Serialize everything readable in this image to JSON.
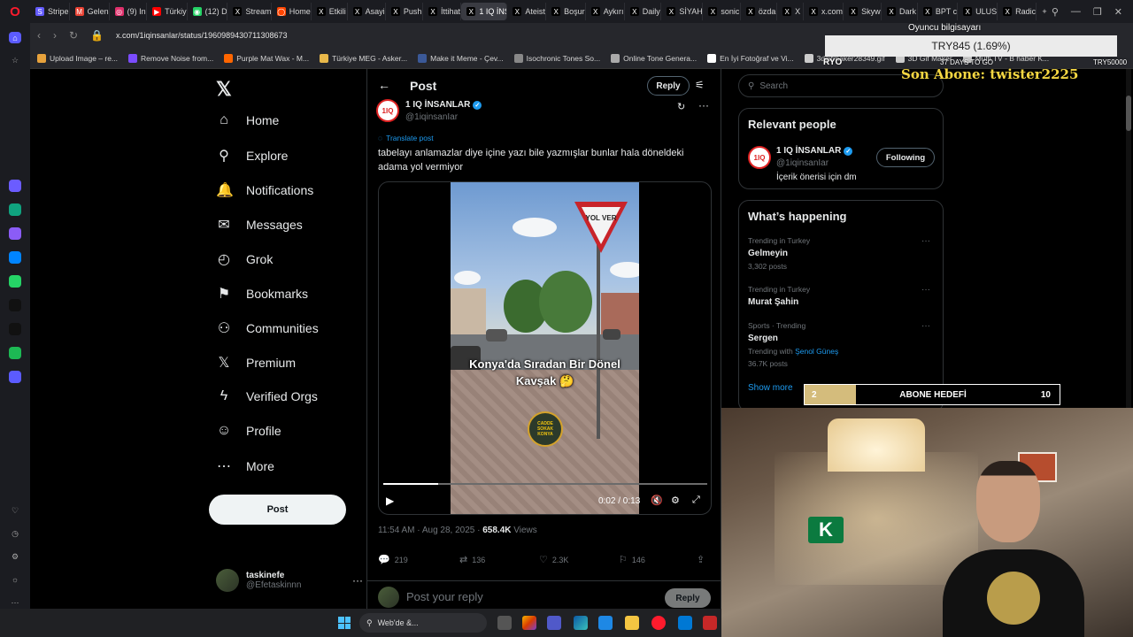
{
  "browser": {
    "tabs": [
      {
        "label": "Stripe",
        "color": "#635bff",
        "glyph": "S"
      },
      {
        "label": "Gelen",
        "color": "#ea4335",
        "glyph": "M"
      },
      {
        "label": "(9) In",
        "color": "#e1306c",
        "glyph": "◎"
      },
      {
        "label": "Türkiy",
        "color": "#ff0000",
        "glyph": "▶"
      },
      {
        "label": "(12) D",
        "color": "#25d366",
        "glyph": "◉"
      },
      {
        "label": "Stream",
        "color": "#000000",
        "glyph": "X"
      },
      {
        "label": "Home",
        "color": "#ff4500",
        "glyph": "◯"
      },
      {
        "label": "Etkili",
        "color": "#000000",
        "glyph": "X"
      },
      {
        "label": "Asayi",
        "color": "#000000",
        "glyph": "X"
      },
      {
        "label": "Push",
        "color": "#000000",
        "glyph": "X"
      },
      {
        "label": "İttihat",
        "color": "#000000",
        "glyph": "X"
      },
      {
        "label": "1 IQ İNSAN",
        "color": "#000000",
        "glyph": "X",
        "active": true
      },
      {
        "label": "Ateist",
        "color": "#000000",
        "glyph": "X"
      },
      {
        "label": "Boşur",
        "color": "#000000",
        "glyph": "X"
      },
      {
        "label": "Aykırı",
        "color": "#000000",
        "glyph": "X"
      },
      {
        "label": "Daily",
        "color": "#000000",
        "glyph": "X"
      },
      {
        "label": "SİYAH",
        "color": "#000000",
        "glyph": "X"
      },
      {
        "label": "sonic",
        "color": "#000000",
        "glyph": "X"
      },
      {
        "label": "özda",
        "color": "#000000",
        "glyph": "X"
      },
      {
        "label": "X",
        "color": "#000000",
        "glyph": "X"
      },
      {
        "label": "x.com",
        "color": "#000000",
        "glyph": "X"
      },
      {
        "label": "Skyw",
        "color": "#000000",
        "glyph": "X"
      },
      {
        "label": "Dark",
        "color": "#000000",
        "glyph": "X"
      },
      {
        "label": "BPT c",
        "color": "#000000",
        "glyph": "X"
      },
      {
        "label": "ULUS",
        "color": "#000000",
        "glyph": "X"
      },
      {
        "label": "Radic",
        "color": "#000000",
        "glyph": "X"
      }
    ],
    "new_tab": "+",
    "url": "x.com/1iqinsanlar/status/1960989430711308673",
    "bookmarks": [
      {
        "label": "Upload Image – re...",
        "color": "#e7a23c"
      },
      {
        "label": "Remove Noise from...",
        "color": "#7b4cff"
      },
      {
        "label": "Purple Mat Wax - M...",
        "color": "#ff6600"
      },
      {
        "label": "Türkiye MEG - Asker...",
        "color": "#e8b84a"
      },
      {
        "label": "Make it Meme - Çev...",
        "color": "#3b5998"
      },
      {
        "label": "Isochronic Tones So...",
        "color": "#888888"
      },
      {
        "label": "Online Tone Genera...",
        "color": "#aaaaaa"
      },
      {
        "label": "En İyi Fotoğraf ve Vi...",
        "color": "#ffffff"
      },
      {
        "label": "3dgifmaker28349.gif",
        "color": "#cccccc"
      },
      {
        "label": "3D Gif Maker",
        "color": "#cccccc"
      },
      {
        "label": "Multi TV - B haber K...",
        "color": "#cccccc"
      }
    ]
  },
  "sidebar_icons": [
    {
      "name": "aria-icon",
      "color": "#6b5cff"
    },
    {
      "name": "chatgpt-icon",
      "color": "#10a37f"
    },
    {
      "name": "cs-icon",
      "color": "#8b5cf6"
    },
    {
      "name": "messenger-icon",
      "color": "#0084ff"
    },
    {
      "name": "whatsapp-icon",
      "color": "#25d366"
    },
    {
      "name": "tiktok-icon",
      "color": "#111111"
    },
    {
      "name": "x-icon",
      "color": "#111111"
    },
    {
      "name": "spotify-icon",
      "color": "#1db954"
    },
    {
      "name": "player-icon",
      "color": "#5b5bff"
    }
  ],
  "nav": {
    "items": [
      {
        "label": "Home",
        "icon": "⌂",
        "name": "home"
      },
      {
        "label": "Explore",
        "icon": "⚲",
        "name": "explore"
      },
      {
        "label": "Notifications",
        "icon": "🔔",
        "name": "notifications"
      },
      {
        "label": "Messages",
        "icon": "✉",
        "name": "messages"
      },
      {
        "label": "Grok",
        "icon": "◴",
        "name": "grok"
      },
      {
        "label": "Bookmarks",
        "icon": "⚑",
        "name": "bookmarks"
      },
      {
        "label": "Communities",
        "icon": "⚇",
        "name": "communities"
      },
      {
        "label": "Premium",
        "icon": "𝕏",
        "name": "premium"
      },
      {
        "label": "Verified Orgs",
        "icon": "ϟ",
        "name": "verified-orgs"
      },
      {
        "label": "Profile",
        "icon": "☺",
        "name": "profile"
      },
      {
        "label": "More",
        "icon": "⋯",
        "name": "more"
      }
    ],
    "post_button": "Post",
    "account": {
      "name": "taskinefe",
      "handle": "@Efetaskinnn"
    }
  },
  "post": {
    "header_title": "Post",
    "reply_pill": "Reply",
    "author_name": "1 IQ İNSANLAR",
    "author_handle": "@1iqinsanIar",
    "avatar_text": "1IQ",
    "translate": "Translate post",
    "text": "tabelayı anlamazlar diye içine yazı bile yazmışlar bunlar hala döneldeki adama yol vermiyor",
    "video": {
      "sign_text": "YOL VER",
      "caption": "Konya'da Sıradan Bir Dönel Kavşak 🤔",
      "logo_text": "CADDE SOKAK KONYA",
      "time": "0:02 / 0:13",
      "progress": 0.17
    },
    "timestamp": "11:54 AM · Aug 28, 2025 · ",
    "views": "658.4K",
    "views_label": " Views",
    "actions": {
      "replies": "219",
      "reposts": "136",
      "likes": "2.3K",
      "bookmarks": "146"
    },
    "reply_placeholder": "Post your reply",
    "reply_button": "Reply"
  },
  "right": {
    "search_placeholder": "Search",
    "relevant_title": "Relevant people",
    "relevant": {
      "name": "1 IQ İNSANLAR",
      "handle": "@1iqinsanIar",
      "bio": "İçerik önerisi için dm",
      "button": "Following",
      "avatar_text": "1IQ"
    },
    "happening_title": "What’s happening",
    "trends": [
      {
        "context": "Trending in Turkey",
        "name": "Gelmeyin",
        "posts": "3,302 posts"
      },
      {
        "context": "Trending in Turkey",
        "name": "Murat Şahin",
        "posts": ""
      },
      {
        "context": "Sports · Trending",
        "name": "Sergen",
        "with_prefix": "Trending with ",
        "with": "Şenol Güneş",
        "posts": "36.7K posts"
      }
    ],
    "show_more": "Show more"
  },
  "overlay": {
    "donate_label": "Oyuncu bilgisayarı",
    "donate_amount": "TRY845 (1.69%)",
    "donate_left": "RYO",
    "donate_mid": "37 DAYS TO GO",
    "donate_right": "TRY50000",
    "sub_name": "Son Abone: twister2225",
    "goal_current": "2",
    "goal_label": "ABONE HEDEFİ",
    "goal_max": "10",
    "goal_fraction": 0.2,
    "webcam_badge": "K"
  },
  "taskbar": {
    "search_text": "Web'de &..."
  }
}
